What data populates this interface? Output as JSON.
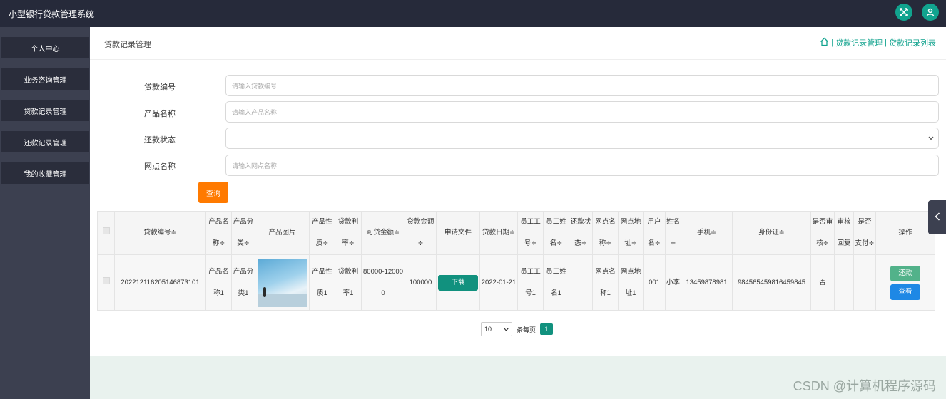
{
  "app": {
    "title": "小型银行贷款管理系统"
  },
  "header_icons": [
    "expand-icon",
    "user-icon"
  ],
  "sidebar": {
    "items": [
      {
        "label": "个人中心"
      },
      {
        "label": "业务咨询管理"
      },
      {
        "label": "贷款记录管理"
      },
      {
        "label": "还款记录管理"
      },
      {
        "label": "我的收藏管理"
      }
    ]
  },
  "breadcrumb": {
    "page_title": "贷款记录管理",
    "sep": "|",
    "level1": "贷款记录管理",
    "level2": "贷款记录列表"
  },
  "search": {
    "loan_no": {
      "label": "贷款编号",
      "placeholder": "请输入贷款编号"
    },
    "product_name": {
      "label": "产品名称",
      "placeholder": "请输入产品名称"
    },
    "repay_status": {
      "label": "还款状态",
      "value": ""
    },
    "branch_name": {
      "label": "网点名称",
      "placeholder": "请输入网点名称"
    },
    "query_button": "查询"
  },
  "table": {
    "headers": [
      "贷款编号≑",
      "产品名称≑",
      "产品分类≑",
      "产品图片",
      "产品性质≑",
      "贷款利率≑",
      "可贷金额≑",
      "贷款金额≑",
      "申请文件",
      "贷款日期≑",
      "员工工号≑",
      "员工姓名≑",
      "还款状态≑",
      "网点名称≑",
      "网点地址≑",
      "用户名≑",
      "姓名≑",
      "手机≑",
      "身份证≑",
      "是否审核≑",
      "审核回复",
      "是否支付≑",
      "操作"
    ],
    "rows": [
      {
        "loan_no": "202212116205146873101",
        "product_name": "产品名称1",
        "product_category": "产品分类1",
        "product_nature": "产品性质1",
        "interest_rate": "贷款利率1",
        "loanable_amount": "80000-120000",
        "loan_amount": "100000",
        "file_button": "下载",
        "loan_date": "2022-01-21",
        "staff_no": "员工工号1",
        "staff_name": "员工姓名1",
        "repay_status": "",
        "branch_name": "网点名称1",
        "branch_addr": "网点地址1",
        "username": "001",
        "name": "小李",
        "phone": "13459878981",
        "id_card": "984565459816459845",
        "audited": "否",
        "audit_reply": "",
        "paid": "",
        "op_repay": "还款",
        "op_view": "查看"
      }
    ]
  },
  "pagination": {
    "page_size": "10",
    "per_page_label": "条每页",
    "current_page": "1"
  },
  "watermark": "CSDN @计算机程序源码",
  "colors": {
    "accent": "#11a38e",
    "topbar": "#262a3a",
    "sidebar": "#3c4050",
    "query": "#ff7a00",
    "view": "#1e88e5"
  }
}
